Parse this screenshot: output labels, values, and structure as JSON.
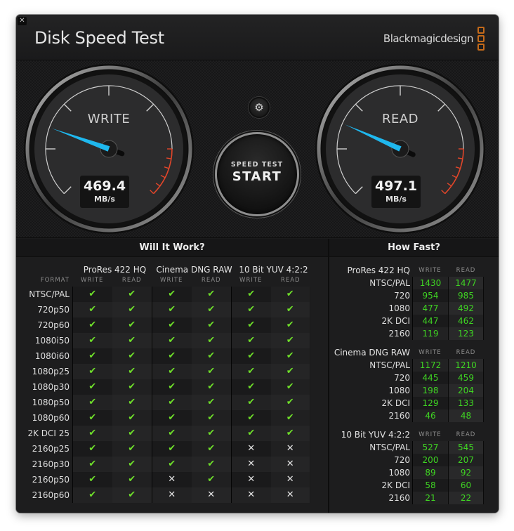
{
  "window": {
    "title": "Disk Speed Test",
    "brand": "Blackmagicdesign",
    "close_glyph": "✕"
  },
  "gauges": {
    "write": {
      "label": "WRITE",
      "value": "469.4",
      "unit": "MB/s",
      "needle_fraction": 0.24
    },
    "read": {
      "label": "READ",
      "value": "497.1",
      "unit": "MB/s",
      "needle_fraction": 0.255
    }
  },
  "controls": {
    "settings_icon": "gear-icon",
    "settings_glyph": "⚙",
    "start_sub": "SPEED TEST",
    "start_main": "START"
  },
  "will_it_work": {
    "title": "Will It Work?",
    "format_label": "FORMAT",
    "groups": [
      "ProRes 422 HQ",
      "Cinema DNG RAW",
      "10 Bit YUV 4:2:2"
    ],
    "subcols": [
      "WRITE",
      "READ",
      "WRITE",
      "READ",
      "WRITE",
      "READ"
    ],
    "rows": [
      {
        "format": "NTSC/PAL",
        "results": [
          true,
          true,
          true,
          true,
          true,
          true
        ]
      },
      {
        "format": "720p50",
        "results": [
          true,
          true,
          true,
          true,
          true,
          true
        ]
      },
      {
        "format": "720p60",
        "results": [
          true,
          true,
          true,
          true,
          true,
          true
        ]
      },
      {
        "format": "1080i50",
        "results": [
          true,
          true,
          true,
          true,
          true,
          true
        ]
      },
      {
        "format": "1080i60",
        "results": [
          true,
          true,
          true,
          true,
          true,
          true
        ]
      },
      {
        "format": "1080p25",
        "results": [
          true,
          true,
          true,
          true,
          true,
          true
        ]
      },
      {
        "format": "1080p30",
        "results": [
          true,
          true,
          true,
          true,
          true,
          true
        ]
      },
      {
        "format": "1080p50",
        "results": [
          true,
          true,
          true,
          true,
          true,
          true
        ]
      },
      {
        "format": "1080p60",
        "results": [
          true,
          true,
          true,
          true,
          true,
          true
        ]
      },
      {
        "format": "2K DCI 25",
        "results": [
          true,
          true,
          true,
          true,
          true,
          true
        ]
      },
      {
        "format": "2160p25",
        "results": [
          true,
          true,
          true,
          true,
          false,
          false
        ]
      },
      {
        "format": "2160p30",
        "results": [
          true,
          true,
          true,
          true,
          false,
          false
        ]
      },
      {
        "format": "2160p50",
        "results": [
          true,
          true,
          false,
          true,
          false,
          false
        ]
      },
      {
        "format": "2160p60",
        "results": [
          true,
          true,
          false,
          false,
          false,
          false
        ]
      }
    ],
    "check_glyph": "✔",
    "cross_glyph": "✕"
  },
  "how_fast": {
    "title": "How Fast?",
    "write_label": "WRITE",
    "read_label": "READ",
    "sections": [
      {
        "codec": "ProRes 422 HQ",
        "rows": [
          {
            "format": "NTSC/PAL",
            "write": "1430",
            "read": "1477"
          },
          {
            "format": "720",
            "write": "954",
            "read": "985"
          },
          {
            "format": "1080",
            "write": "477",
            "read": "492"
          },
          {
            "format": "2K DCI",
            "write": "447",
            "read": "462"
          },
          {
            "format": "2160",
            "write": "119",
            "read": "123"
          }
        ]
      },
      {
        "codec": "Cinema DNG RAW",
        "rows": [
          {
            "format": "NTSC/PAL",
            "write": "1172",
            "read": "1210"
          },
          {
            "format": "720",
            "write": "445",
            "read": "459"
          },
          {
            "format": "1080",
            "write": "198",
            "read": "204"
          },
          {
            "format": "2K DCI",
            "write": "129",
            "read": "133"
          },
          {
            "format": "2160",
            "write": "46",
            "read": "48"
          }
        ]
      },
      {
        "codec": "10 Bit YUV 4:2:2",
        "rows": [
          {
            "format": "NTSC/PAL",
            "write": "527",
            "read": "545"
          },
          {
            "format": "720",
            "write": "200",
            "read": "207"
          },
          {
            "format": "1080",
            "write": "89",
            "read": "92"
          },
          {
            "format": "2K DCI",
            "write": "58",
            "read": "60"
          },
          {
            "format": "2160",
            "write": "21",
            "read": "22"
          }
        ]
      }
    ]
  },
  "colors": {
    "needle": "#1fb8ee",
    "redline": "#e2462a",
    "ok_green": "#6fe02a",
    "value_green": "#3fd423",
    "brand_orange": "#c46a1a"
  }
}
